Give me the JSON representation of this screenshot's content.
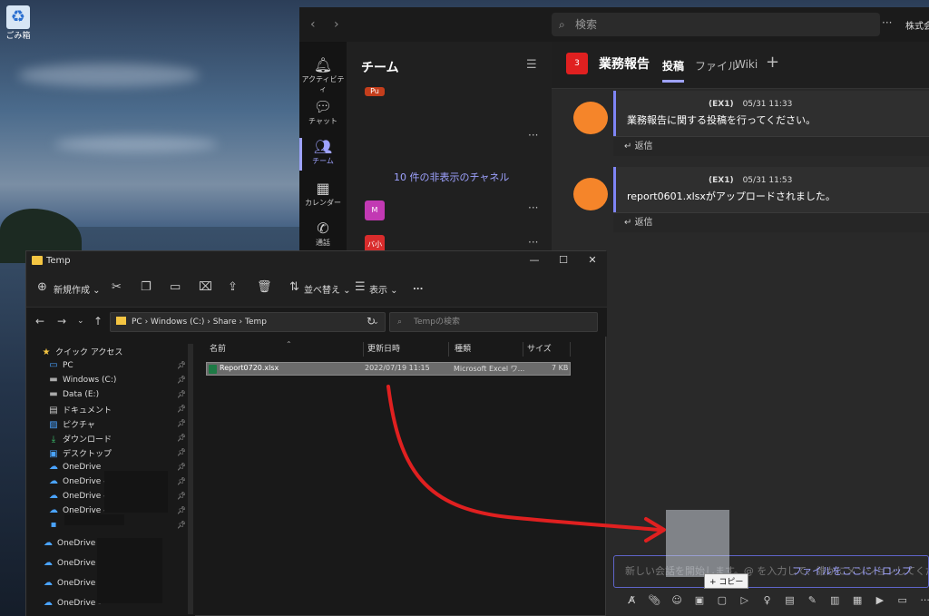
{
  "desktop": {
    "recycle_label": "ごみ箱"
  },
  "teams": {
    "search_placeholder": "検索",
    "org_name": "株式会",
    "rail": [
      {
        "label": "アクティビティ",
        "icon": "bell-icon"
      },
      {
        "label": "チャット",
        "icon": "chat-icon"
      },
      {
        "label": "チーム",
        "icon": "teams-icon"
      },
      {
        "label": "カレンダー",
        "icon": "calendar-icon"
      },
      {
        "label": "通話",
        "icon": "phone-icon"
      }
    ],
    "channel_list": {
      "title": "チーム",
      "hidden_channels": "10 件の非表示のチャネル",
      "badges": [
        {
          "text": "Pu",
          "color": "#c43e1c"
        },
        {
          "text": "M",
          "color": "#c239b3"
        },
        {
          "text": "バ小",
          "color": "#d92c2c"
        }
      ]
    },
    "channel": {
      "badge": "3",
      "name": "業務報告",
      "tabs": [
        "投稿",
        "ファイル",
        "Wiki"
      ],
      "add_tab": "+"
    },
    "posts": [
      {
        "author": "(EX1)",
        "time": "05/31 11:33",
        "body": "業務報告に関する投稿を行ってください。",
        "reply": "返信"
      },
      {
        "author": "(EX1)",
        "time": "05/31 11:53",
        "body": "report0601.xlsxがアップロードされました。",
        "reply": "返信"
      }
    ],
    "compose": {
      "placeholder": "新しい会話を開始します。@ を入力して、誰かにメンションしてください。",
      "drop_hint": "ファイルをここにドロップ",
      "copy_tooltip": "+ コピー"
    },
    "accent": "#9ea2ff"
  },
  "explorer": {
    "title": "Temp",
    "commands": {
      "new": "新規作成",
      "sort": "並べ替え",
      "view": "表示",
      "more": "..."
    },
    "address": "PC  ›  Windows (C:)  ›  Share  ›  Temp",
    "search_placeholder": "Tempの検索",
    "nav": [
      {
        "label": "クイック アクセス",
        "icon": "star-icon",
        "pin": false
      },
      {
        "label": "PC",
        "icon": "pc-icon",
        "pin": true
      },
      {
        "label": "Windows (C:)",
        "icon": "drive-icon",
        "pin": true
      },
      {
        "label": "Data (E:)",
        "icon": "drive-icon",
        "pin": true
      },
      {
        "label": "ドキュメント",
        "icon": "document-icon",
        "pin": true
      },
      {
        "label": "ピクチャ",
        "icon": "picture-icon",
        "pin": true
      },
      {
        "label": "ダウンロード",
        "icon": "download-icon",
        "pin": true
      },
      {
        "label": "デスクトップ",
        "icon": "desktop-icon",
        "pin": true
      },
      {
        "label": "OneDrive",
        "icon": "cloud-icon",
        "pin": true
      },
      {
        "label": "OneDrive -",
        "icon": "cloud-icon",
        "pin": true
      },
      {
        "label": "OneDrive -",
        "icon": "cloud-icon",
        "pin": true
      },
      {
        "label": "OneDrive -",
        "icon": "cloud-icon",
        "pin": true
      },
      {
        "label": "",
        "icon": "folder-icon",
        "pin": true
      },
      {
        "label": "OneDrive -",
        "icon": "cloud-icon",
        "pin": false
      },
      {
        "label": "OneDrive -",
        "icon": "cloud-icon",
        "pin": false
      },
      {
        "label": "OneDrive -",
        "icon": "cloud-icon",
        "pin": false
      },
      {
        "label": "OneDrive -",
        "icon": "cloud-icon",
        "pin": false
      }
    ],
    "columns": [
      "名前",
      "更新日時",
      "種類",
      "サイズ"
    ],
    "files": [
      {
        "name": "Report0720.xlsx",
        "modified": "2022/07/19 11:15",
        "type": "Microsoft Excel ワ...",
        "size": "7 KB"
      }
    ]
  }
}
